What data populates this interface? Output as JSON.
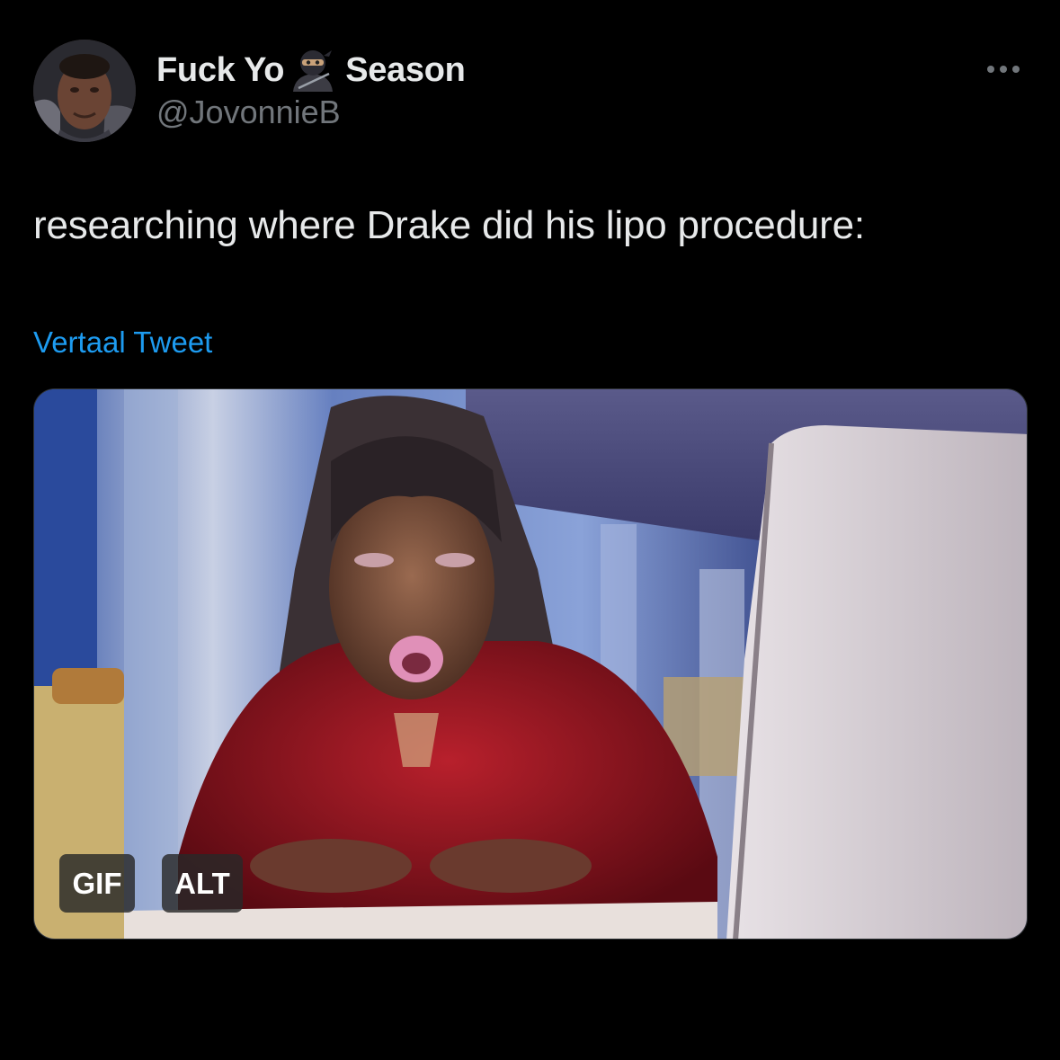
{
  "tweet": {
    "display_name_prefix": "Fuck Yo",
    "display_name_emoji": "ninja-emoji",
    "display_name_suffix": "Season",
    "handle": "@JovonnieB",
    "text": "researching where Drake did his lipo procedure:",
    "translate_label": "Vertaal Tweet",
    "more_icon": "more-horizontal-icon"
  },
  "media": {
    "type": "gif",
    "gif_badge": "GIF",
    "alt_badge": "ALT"
  },
  "colors": {
    "background": "#000000",
    "primary_text": "#e7e9ea",
    "secondary_text": "#71767b",
    "link": "#1d9bf0"
  }
}
